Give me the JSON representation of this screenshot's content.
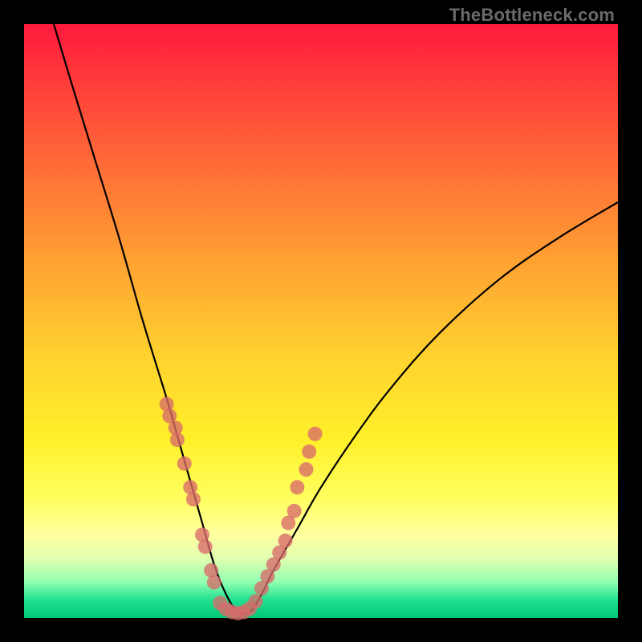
{
  "watermark": "TheBottleneck.com",
  "colors": {
    "frame_bg_top": "#ff1a3c",
    "frame_bg_bottom": "#00c878",
    "curve": "#000000",
    "markers": "#d96a6a",
    "page_bg": "#000000",
    "watermark": "#6a6a6a"
  },
  "chart_data": {
    "type": "line",
    "title": "",
    "xlabel": "",
    "ylabel": "",
    "xlim": [
      0,
      100
    ],
    "ylim": [
      0,
      100
    ],
    "grid": false,
    "legend": false,
    "note": "Axes unlabeled in source image; values are relative 0–100. Curve is an absolute-value-like bottleneck curve with minimum near x≈36.",
    "series": [
      {
        "name": "bottleneck-curve",
        "type": "line",
        "x": [
          5,
          8,
          12,
          16,
          20,
          24,
          26,
          28,
          30,
          32,
          34,
          36,
          38,
          40,
          42,
          46,
          50,
          56,
          62,
          70,
          80,
          90,
          100
        ],
        "y": [
          100,
          90,
          77,
          64,
          50,
          37,
          30,
          23,
          16,
          9,
          4,
          1,
          1,
          4,
          8,
          15,
          22,
          31,
          39,
          48,
          57,
          64,
          70
        ]
      },
      {
        "name": "left-cluster-markers",
        "type": "scatter",
        "x": [
          24.0,
          24.5,
          25.5,
          25.8,
          27.0,
          28.0,
          28.5,
          30.0,
          30.5,
          31.5,
          32.0
        ],
        "y": [
          36.0,
          34.0,
          32.0,
          30.0,
          26.0,
          22.0,
          20.0,
          14.0,
          12.0,
          8.0,
          6.0
        ]
      },
      {
        "name": "bottom-markers",
        "type": "scatter",
        "x": [
          33.0,
          34.0,
          35.0,
          36.0,
          37.0,
          38.0,
          39.0
        ],
        "y": [
          2.5,
          1.5,
          1.0,
          0.8,
          1.0,
          1.6,
          2.8
        ]
      },
      {
        "name": "right-cluster-markers",
        "type": "scatter",
        "x": [
          40.0,
          41.0,
          42.0,
          43.0,
          44.0,
          44.5,
          45.5,
          46.0,
          47.5,
          48.0,
          49.0
        ],
        "y": [
          5.0,
          7.0,
          9.0,
          11.0,
          13.0,
          16.0,
          18.0,
          22.0,
          25.0,
          28.0,
          31.0
        ]
      }
    ]
  }
}
